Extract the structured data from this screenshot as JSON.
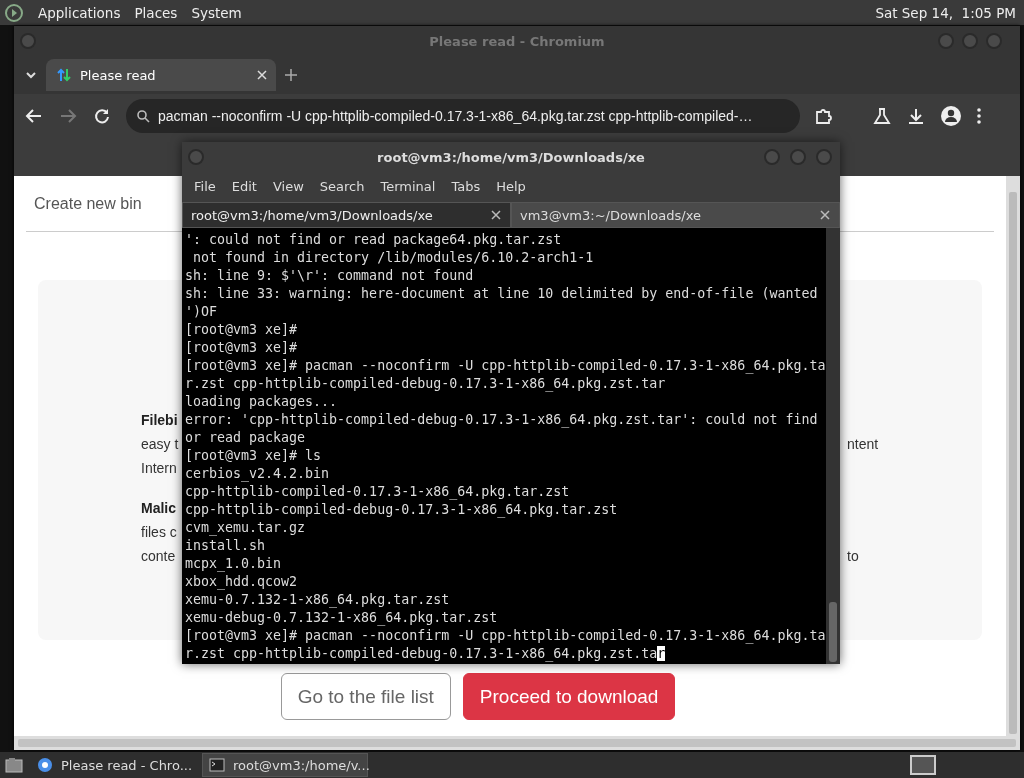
{
  "top_panel": {
    "menus": [
      "Applications",
      "Places",
      "System"
    ],
    "clock": "Sat Sep 14,  1:05 PM"
  },
  "browser": {
    "title": "Please read - Chromium",
    "tabs": [
      {
        "label": "Please read",
        "selected": true
      }
    ],
    "address": "pacman --noconfirm -U cpp-httplib-compiled-0.17.3-1-x86_64.pkg.tar.zst cpp-httplib-compiled-…",
    "forward_disabled": true,
    "page": {
      "nav_link": "Create new bin",
      "rows": [
        {
          "kind": "heading",
          "left": "Filebi"
        },
        {
          "kind": "text",
          "left": "easy t",
          "right": "ntent"
        },
        {
          "kind": "text",
          "left": "Intern"
        },
        {
          "kind": "heading",
          "left": "Malic"
        },
        {
          "kind": "text",
          "left": "files c"
        },
        {
          "kind": "text",
          "left": "conte",
          "right": "to"
        }
      ],
      "buttons": [
        {
          "kind": "outline",
          "label": "Go to the file list"
        },
        {
          "kind": "primary",
          "label": "Proceed to download"
        }
      ]
    }
  },
  "terminal": {
    "title": "root@vm3:/home/vm3/Downloads/xe",
    "menus": [
      "File",
      "Edit",
      "View",
      "Search",
      "Terminal",
      "Tabs",
      "Help"
    ],
    "tabs": [
      {
        "label": "root@vm3:/home/vm3/Downloads/xe",
        "selected": true
      },
      {
        "label": "vm3@vm3:~/Downloads/xe",
        "selected": false
      }
    ],
    "lines": [
      "': could not find or read package64.pkg.tar.zst",
      " not found in directory /lib/modules/6.10.2-arch1-1",
      "sh: line 9: $'\\r': command not found",
      "sh: line 33: warning: here-document at line 10 delimited by end-of-file (wanted",
      "')OF",
      "[root@vm3 xe]#",
      "[root@vm3 xe]#",
      "[root@vm3 xe]# pacman --noconfirm -U cpp-httplib-compiled-0.17.3-1-x86_64.pkg.ta",
      "r.zst cpp-httplib-compiled-debug-0.17.3-1-x86_64.pkg.zst.tar",
      "loading packages...",
      "error: 'cpp-httplib-compiled-debug-0.17.3-1-x86_64.pkg.zst.tar': could not find",
      "or read package",
      "[root@vm3 xe]# ls",
      "cerbios_v2.4.2.bin",
      "cpp-httplib-compiled-0.17.3-1-x86_64.pkg.tar.zst",
      "cpp-httplib-compiled-debug-0.17.3-1-x86_64.pkg.tar.zst",
      "cvm_xemu.tar.gz",
      "install.sh",
      "mcpx_1.0.bin",
      "xbox_hdd.qcow2",
      "xemu-0.7.132-1-x86_64.pkg.tar.zst",
      "xemu-debug-0.7.132-1-x86_64.pkg.tar.zst",
      "[root@vm3 xe]# pacman --noconfirm -U cpp-httplib-compiled-0.17.3-1-x86_64.pkg.ta",
      "r.zst cpp-httplib-compiled-debug-0.17.3-1-x86_64.pkg.zst.tar"
    ],
    "cursor_on_last_char": true
  },
  "taskbar": {
    "items": [
      {
        "label": "Please read - Chro...",
        "kind": "browser",
        "selected": false
      },
      {
        "label": "root@vm3:/home/v...",
        "kind": "terminal",
        "selected": true
      }
    ]
  }
}
